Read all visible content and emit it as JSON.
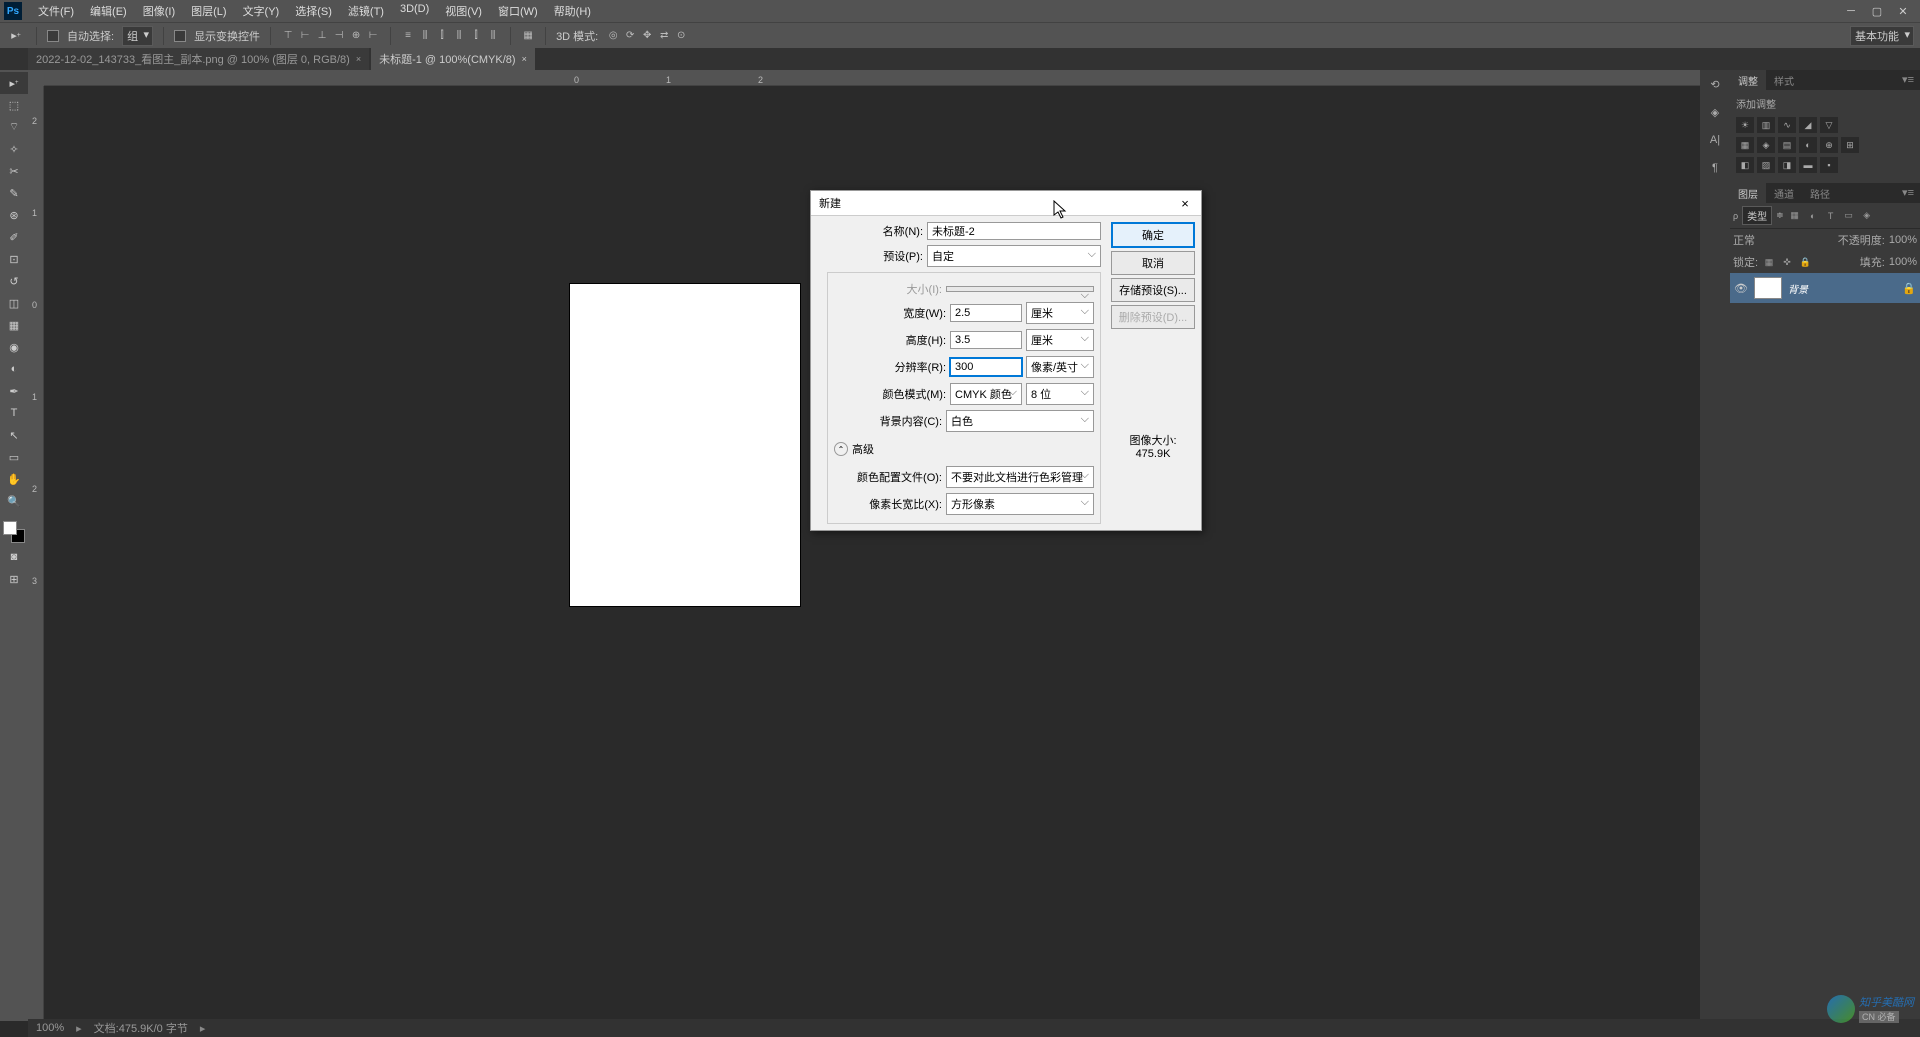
{
  "menubar": {
    "items": [
      "文件(F)",
      "编辑(E)",
      "图像(I)",
      "图层(L)",
      "文字(Y)",
      "选择(S)",
      "滤镜(T)",
      "3D(D)",
      "视图(V)",
      "窗口(W)",
      "帮助(H)"
    ]
  },
  "options": {
    "auto_select_label": "自动选择:",
    "auto_select_value": "组",
    "show_transform_label": "显示变换控件",
    "mode_3d_label": "3D 模式:",
    "workspace_label": "基本功能"
  },
  "tabs": [
    {
      "label": "2022-12-02_143733_看图主_副本.png @ 100% (图层 0, RGB/8)",
      "active": false
    },
    {
      "label": "未标题-1 @ 100%(CMYK/8)",
      "active": true
    }
  ],
  "ruler_h": [
    "0",
    "1",
    "2"
  ],
  "ruler_v": [
    "2",
    "1",
    "0",
    "1",
    "2",
    "3"
  ],
  "panels": {
    "adjustments_tab": "调整",
    "styles_tab": "样式",
    "add_adjustment": "添加调整",
    "layers_tab": "图层",
    "channels_tab": "通道",
    "paths_tab": "路径",
    "kind_label": "类型",
    "blend_mode": "正常",
    "opacity_label": "不透明度:",
    "opacity_value": "100%",
    "lock_label": "锁定:",
    "fill_label": "填充:",
    "fill_value": "100%",
    "layer_name": "背景"
  },
  "statusbar": {
    "zoom": "100%",
    "doc_info": "文档:475.9K/0 字节"
  },
  "dialog": {
    "title": "新建",
    "name_label": "名称(N):",
    "name_value": "未标题-2",
    "preset_label": "预设(P):",
    "preset_value": "自定",
    "size_label": "大小(I):",
    "width_label": "宽度(W):",
    "width_value": "2.5",
    "width_unit": "厘米",
    "height_label": "高度(H):",
    "height_value": "3.5",
    "height_unit": "厘米",
    "resolution_label": "分辨率(R):",
    "resolution_value": "300",
    "resolution_unit": "像素/英寸",
    "color_mode_label": "颜色模式(M):",
    "color_mode_value": "CMYK 颜色",
    "color_depth": "8 位",
    "bg_label": "背景内容(C):",
    "bg_value": "白色",
    "advanced_label": "高级",
    "color_profile_label": "颜色配置文件(O):",
    "color_profile_value": "不要对此文档进行色彩管理",
    "pixel_ratio_label": "像素长宽比(X):",
    "pixel_ratio_value": "方形像素",
    "ok": "确定",
    "cancel": "取消",
    "save_preset": "存储预设(S)...",
    "delete_preset": "删除预设(D)...",
    "image_size_label": "图像大小:",
    "image_size_value": "475.9K"
  },
  "watermark": {
    "cn": "CN 必备",
    "brand": "知乎美酷网"
  }
}
